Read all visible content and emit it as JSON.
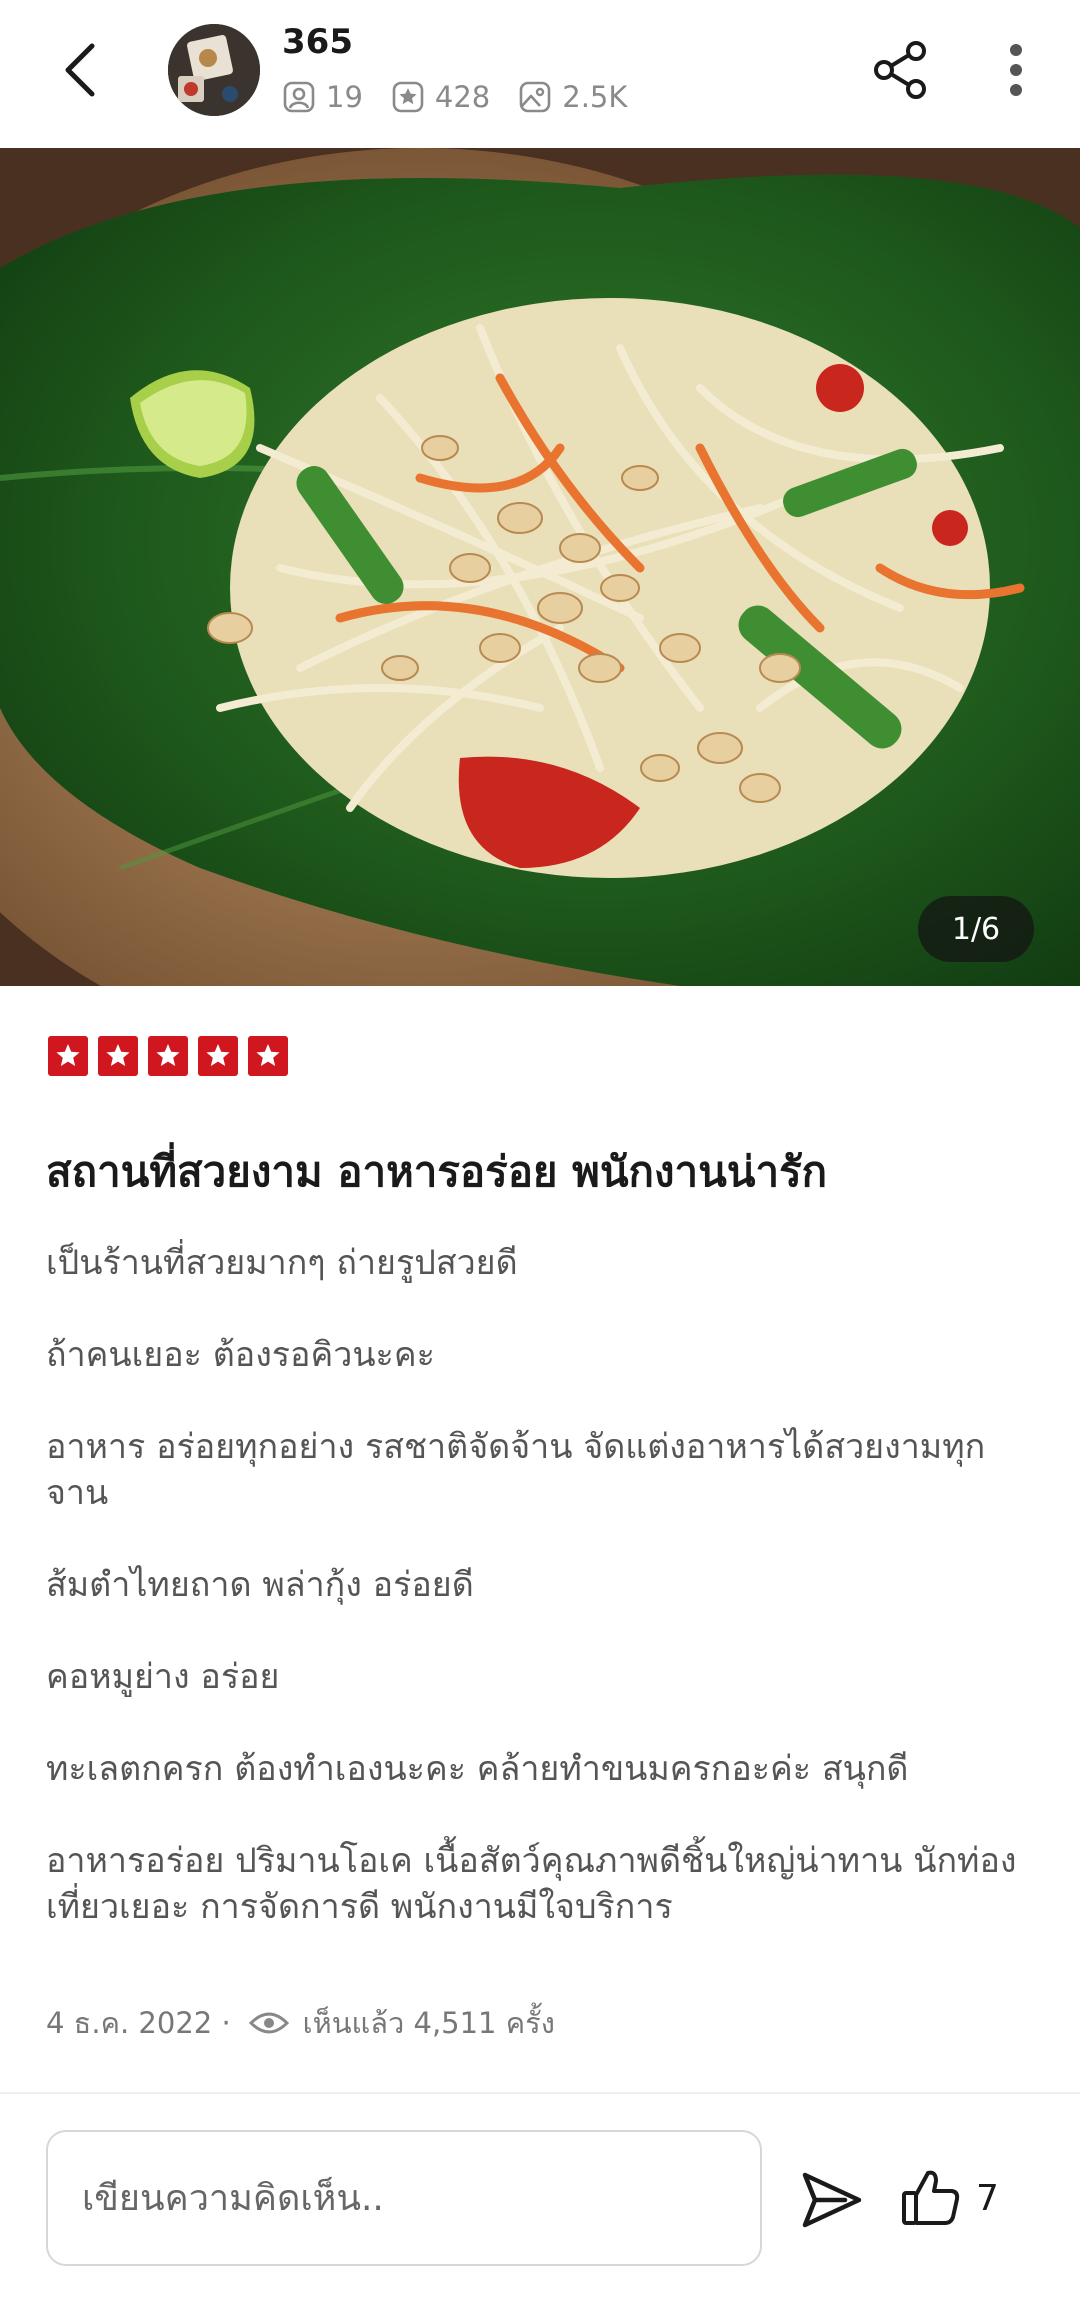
{
  "header": {
    "user_name": "365",
    "stats": {
      "followers": "19",
      "reviews": "428",
      "photos": "2.5K"
    }
  },
  "photo": {
    "counter": "1/6",
    "current_index": 1,
    "total": 6
  },
  "review": {
    "rating": 5,
    "title": "สถานที่สวยงาม อาหารอร่อย พนักงานน่ารัก",
    "paragraphs": [
      "เป็นร้านที่สวยมากๆ ถ่ายรูปสวยดี",
      "ถ้าคนเยอะ ต้องรอคิวนะคะ",
      "อาหาร อร่อยทุกอย่าง รสชาติจัดจ้าน จัดแต่งอาหารได้สวยงามทุกจาน",
      "ส้มตำไทยถาด พล่ากุ้ง อร่อยดี",
      "คอหมูย่าง อร่อย",
      "ทะเลตกครก ต้องทำเองนะคะ คล้ายทำขนมครกอะค่ะ สนุกดี",
      "อาหารอร่อย ปริมานโอเค เนื้อสัตว์คุณภาพดีชิ้นใหญ่น่าทาน นักท่องเที่ยวเยอะ การจัดการดี พนักงานมีใจบริการ"
    ],
    "date": "4 ธ.ค. 2022 ·",
    "views": "เห็นแล้ว 4,511 ครั้ง"
  },
  "comment": {
    "placeholder": "เขียนความคิดเห็น.."
  },
  "likes": {
    "count": "7"
  },
  "colors": {
    "star_red": "#d0161f",
    "text_primary": "#1a1a1a",
    "text_secondary": "#555555",
    "meta_gray": "#777777"
  }
}
